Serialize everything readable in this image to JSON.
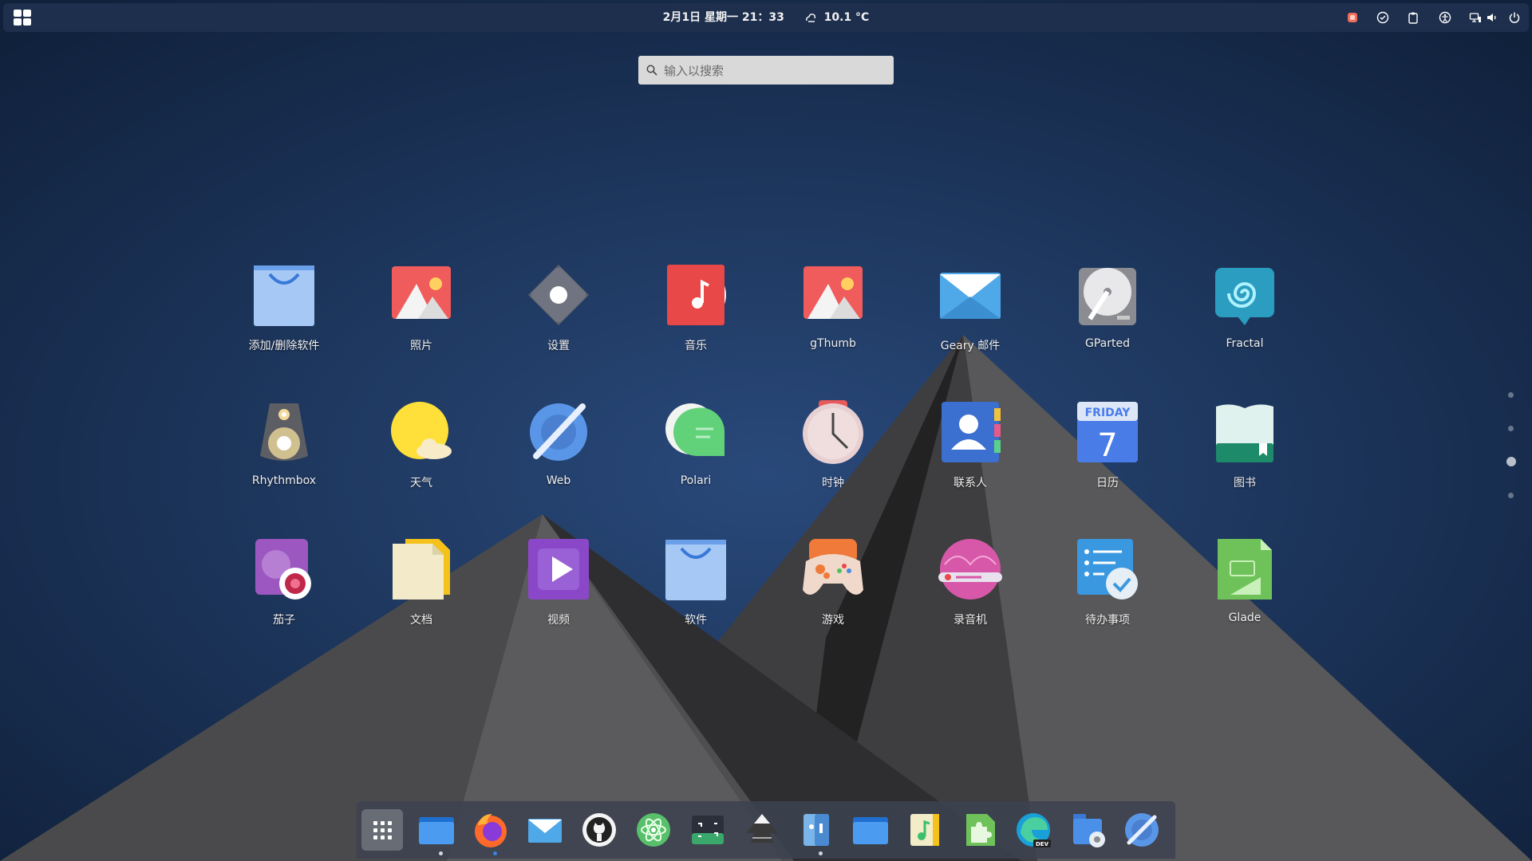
{
  "topbar": {
    "activities_icon": "grid-icon",
    "datetime": "2月1日 星期一  21：33",
    "weather_icon": "weather-icon",
    "temperature": "10.1 °C",
    "tray_icons": [
      "record-icon",
      "check-circle-icon",
      "clipboard-icon",
      "accessibility-icon",
      "network-icon",
      "volume-icon",
      "power-icon"
    ]
  },
  "search": {
    "placeholder": "输入以搜索",
    "value": ""
  },
  "apps": [
    {
      "label": "添加/删除软件",
      "icon": "software-bag-icon"
    },
    {
      "label": "照片",
      "icon": "photos-icon"
    },
    {
      "label": "设置",
      "icon": "settings-icon"
    },
    {
      "label": "音乐",
      "icon": "music-icon"
    },
    {
      "label": "gThumb",
      "icon": "gthumb-icon"
    },
    {
      "label": "Geary 邮件",
      "icon": "mail-icon"
    },
    {
      "label": "GParted",
      "icon": "disk-icon"
    },
    {
      "label": "Fractal",
      "icon": "fractal-icon"
    },
    {
      "label": "Rhythmbox",
      "icon": "speaker-icon"
    },
    {
      "label": "天气",
      "icon": "weather-sun-icon"
    },
    {
      "label": "Web",
      "icon": "web-compass-icon"
    },
    {
      "label": "Polari",
      "icon": "chat-icon"
    },
    {
      "label": "时钟",
      "icon": "clock-icon"
    },
    {
      "label": "联系人",
      "icon": "contacts-icon"
    },
    {
      "label": "日历",
      "icon": "calendar-icon",
      "icon_text_top": "FRIDAY",
      "icon_text_day": "7"
    },
    {
      "label": "图书",
      "icon": "books-icon"
    },
    {
      "label": "茄子",
      "icon": "cheese-icon"
    },
    {
      "label": "文档",
      "icon": "documents-icon"
    },
    {
      "label": "视频",
      "icon": "video-icon"
    },
    {
      "label": "软件",
      "icon": "software-icon"
    },
    {
      "label": "游戏",
      "icon": "gamepad-icon"
    },
    {
      "label": "录音机",
      "icon": "sound-recorder-icon"
    },
    {
      "label": "待办事项",
      "icon": "todo-icon"
    },
    {
      "label": "Glade",
      "icon": "glade-icon"
    }
  ],
  "pagination": {
    "pages": 4,
    "current": 3
  },
  "dock": {
    "items": [
      {
        "icon": "app-grid-icon",
        "active": true,
        "running": false
      },
      {
        "icon": "folder-icon",
        "running": true
      },
      {
        "icon": "firefox-icon",
        "running": true
      },
      {
        "icon": "mail-icon",
        "running": false
      },
      {
        "icon": "github-icon",
        "running": false
      },
      {
        "icon": "atom-icon",
        "running": false
      },
      {
        "icon": "terminal-screenshot-icon",
        "running": false
      },
      {
        "icon": "inkscape-icon",
        "running": false
      },
      {
        "icon": "builder-icon",
        "running": true
      },
      {
        "icon": "files-icon",
        "running": false
      },
      {
        "icon": "music-note-icon",
        "running": false
      },
      {
        "icon": "extensions-icon",
        "running": false
      },
      {
        "icon": "edge-dev-icon",
        "running": false,
        "badge": "DEV"
      },
      {
        "icon": "disk-usage-icon",
        "running": false
      },
      {
        "icon": "web-compass-icon",
        "running": false
      }
    ]
  },
  "colors": {
    "topbar": "#1e2f4d",
    "wallpaper_top": "#12243f",
    "wallpaper_bottom": "#223e6c",
    "accent": "#3584e4"
  }
}
